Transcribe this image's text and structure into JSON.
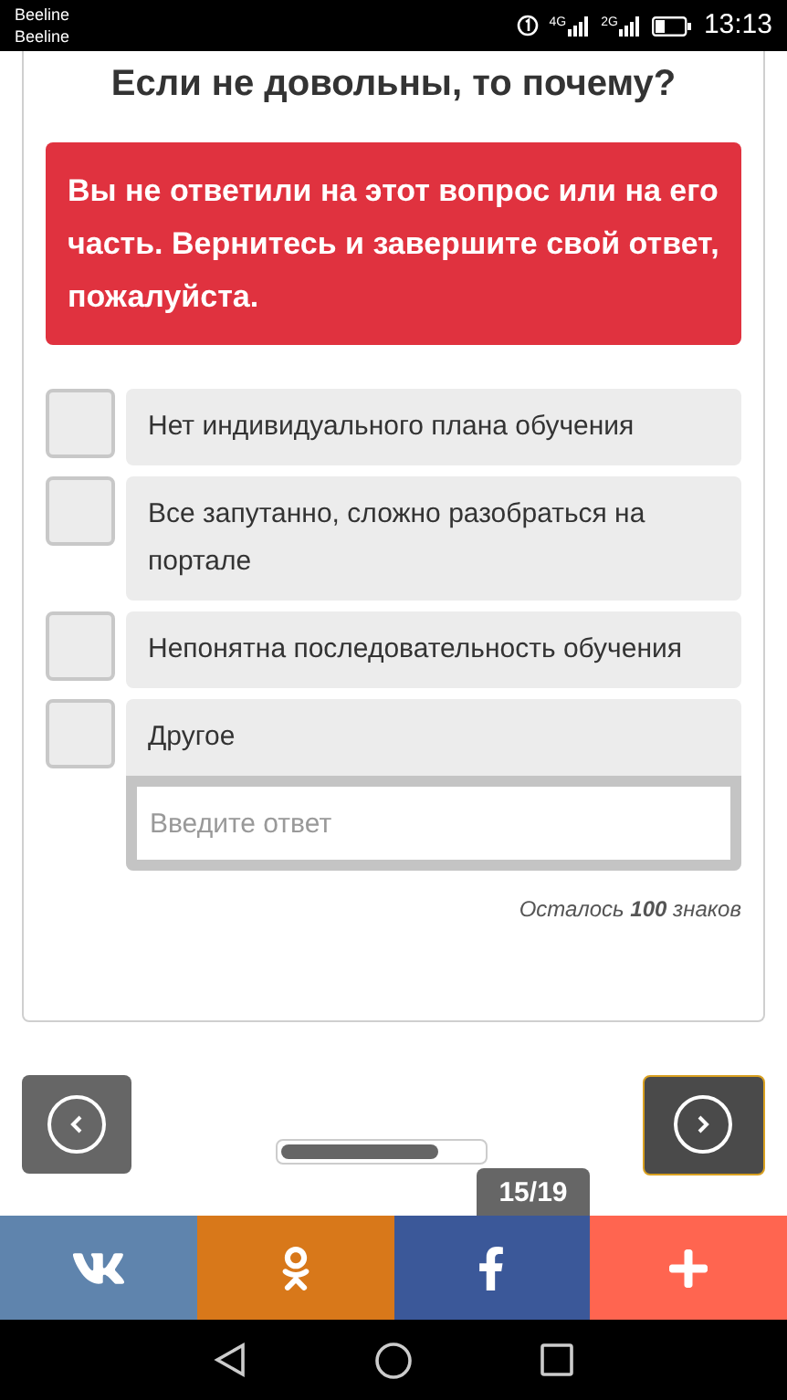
{
  "status_bar": {
    "carriers": [
      "Beeline",
      "Beeline"
    ],
    "networks": [
      "4G",
      "2G"
    ],
    "time": "13:13"
  },
  "question": {
    "title": "Если не довольны, то почему?",
    "error": "Вы не ответили на этот вопрос или на его часть. Вернитесь и завершите свой ответ, пожалуйста.",
    "options": [
      {
        "label": "Нет индивидуального плана обучения",
        "checked": false
      },
      {
        "label": "Все запутанно, сложно разобраться на портале",
        "checked": false
      },
      {
        "label": "Непонятна последовательность обучения",
        "checked": false
      },
      {
        "label": "Другое",
        "checked": false,
        "input": {
          "placeholder": "Введите ответ"
        }
      }
    ],
    "counter": "Осталось **100** знаков"
  },
  "navigation": {
    "progress": {
      "level": 0.78
    },
    "page": "15/19"
  },
  "share_bar": [
    {
      "kind": "vk"
    },
    {
      "kind": "ok"
    },
    {
      "kind": "facebook"
    },
    {
      "kind": "more"
    }
  ]
}
